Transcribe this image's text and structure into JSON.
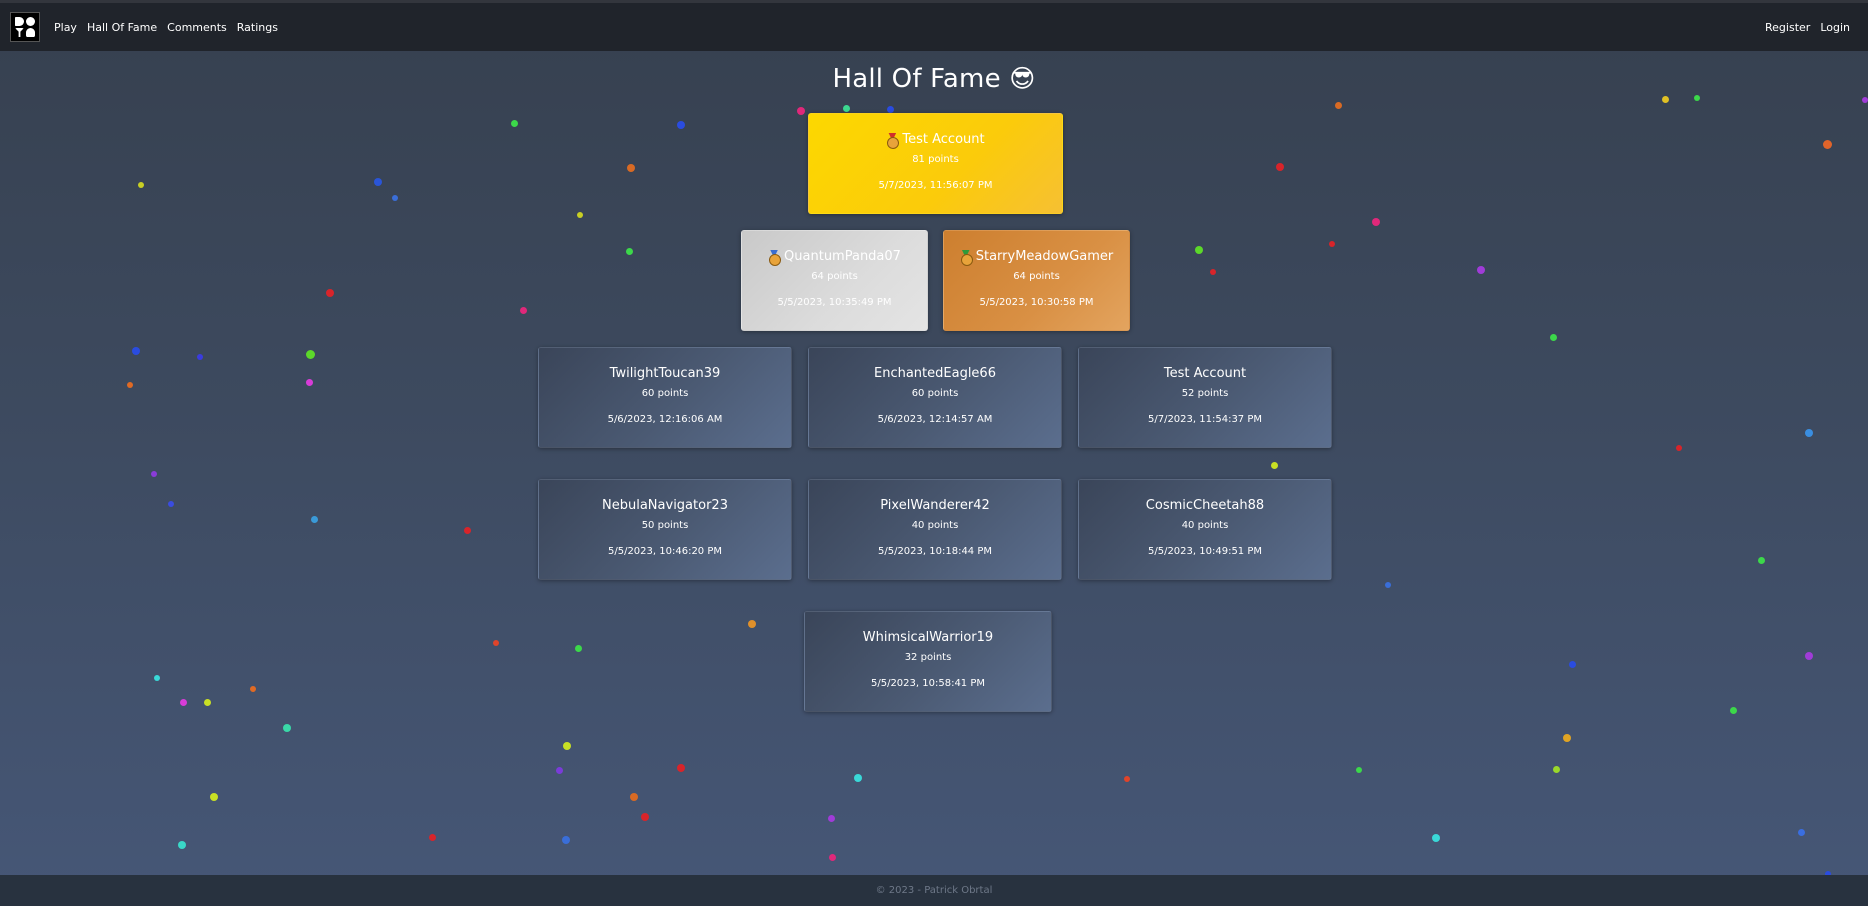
{
  "nav": {
    "logo": "logo-icon",
    "links": [
      "Play",
      "Hall Of Fame",
      "Comments",
      "Ratings"
    ],
    "register": "Register",
    "login": "Login"
  },
  "page": {
    "title": "Hall Of Fame",
    "title_emoji": "😎"
  },
  "podium": {
    "first": {
      "name": "Test Account",
      "points": "81 points",
      "date": "5/7/2023, 11:56:07 PM"
    },
    "second": {
      "name": "QuantumPanda07",
      "points": "64 points",
      "date": "5/5/2023, 10:35:49 PM"
    },
    "third": {
      "name": "StarryMeadowGamer",
      "points": "64 points",
      "date": "5/5/2023, 10:30:58 PM"
    }
  },
  "entries": [
    {
      "name": "TwilightToucan39",
      "points": "60 points",
      "date": "5/6/2023, 12:16:06 AM"
    },
    {
      "name": "EnchantedEagle66",
      "points": "60 points",
      "date": "5/6/2023, 12:14:57 AM"
    },
    {
      "name": "Test Account",
      "points": "52 points",
      "date": "5/7/2023, 11:54:37 PM"
    },
    {
      "name": "NebulaNavigator23",
      "points": "50 points",
      "date": "5/5/2023, 10:46:20 PM"
    },
    {
      "name": "PixelWanderer42",
      "points": "40 points",
      "date": "5/5/2023, 10:18:44 PM"
    },
    {
      "name": "CosmicCheetah88",
      "points": "40 points",
      "date": "5/5/2023, 10:49:51 PM"
    },
    {
      "name": "WhimsicalWarrior19",
      "points": "32 points",
      "date": "5/5/2023, 10:58:41 PM"
    }
  ],
  "footer": {
    "text": "© 2023 - Patrick Obrtal"
  },
  "colors": {
    "navbar": "#20242b",
    "gold": "#fcd800",
    "silver": "#d4d4d4",
    "bronze": "#d78a3c",
    "card": "#4b5a73",
    "footer": "#28323f"
  }
}
